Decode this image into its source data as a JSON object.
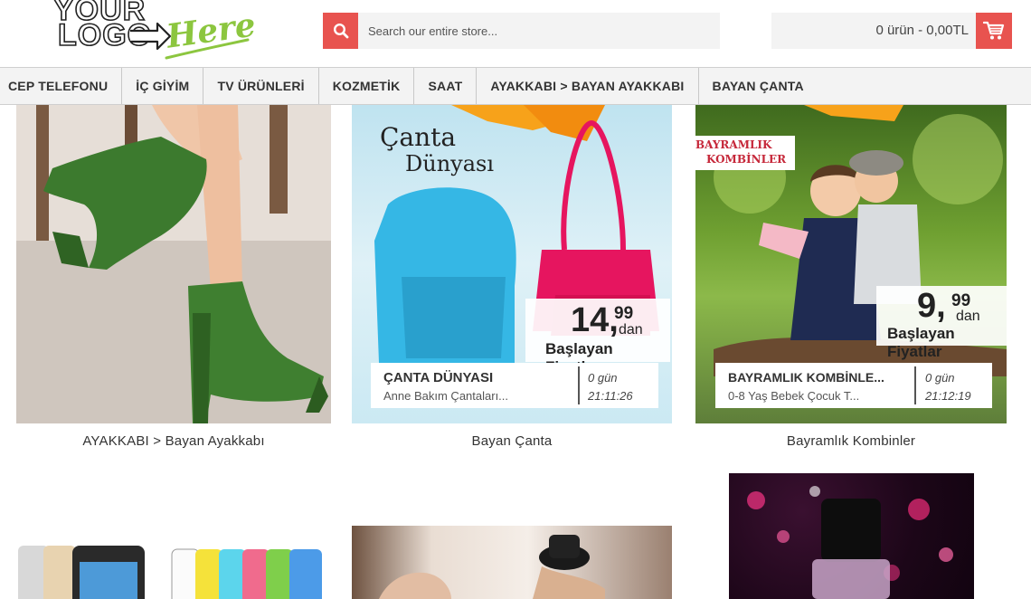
{
  "logo": {
    "line1": "YOUR",
    "line2": "LOGO",
    "accent": "Here"
  },
  "search": {
    "placeholder": "Search our entire store...",
    "icon": "search-icon"
  },
  "cart": {
    "summary": "0 ürün - 0,00TL",
    "icon": "cart-icon"
  },
  "colors": {
    "accent": "#e8534f",
    "logo_green": "#8cc63f",
    "bar_bg": "#f3f3f3"
  },
  "nav": {
    "items": [
      {
        "label": "CEP TELEFONU"
      },
      {
        "label": "İÇ GİYİM"
      },
      {
        "label": "TV ÜRÜNLERİ"
      },
      {
        "label": "KOZMETİK"
      },
      {
        "label": "SAAT"
      },
      {
        "label": "AYAKKABI > BAYAN AYAKKABI"
      },
      {
        "label": "BAYAN ÇANTA"
      }
    ]
  },
  "products": [
    {
      "caption": "AYAKKABI > Bayan Ayakkabı"
    },
    {
      "caption": "Bayan Çanta",
      "banner_title_1": "Çanta",
      "banner_title_2": "Dünyası",
      "price_main": "14,",
      "price_dec": "99",
      "price_dan": "dan",
      "price_label": "Başlayan Fiyatlar",
      "promo_title": "ÇANTA DÜNYASI",
      "promo_sub": "Anne Bakım Çantaları...",
      "promo_days": "0 gün",
      "promo_time": "21:11:26"
    },
    {
      "caption": "Bayramlık Kombinler",
      "banner_tag_1": "BAYRAMLIK",
      "banner_tag_2": "KOMBİNLER",
      "price_main": "9,",
      "price_dec": "99",
      "price_dan": "dan",
      "price_label": "Başlayan Fiyatlar",
      "promo_title": "BAYRAMLIK KOMBİNLE...",
      "promo_sub": "0-8 Yaş Bebek Çocuk T...",
      "promo_days": "0 gün",
      "promo_time": "21:12:19"
    }
  ]
}
